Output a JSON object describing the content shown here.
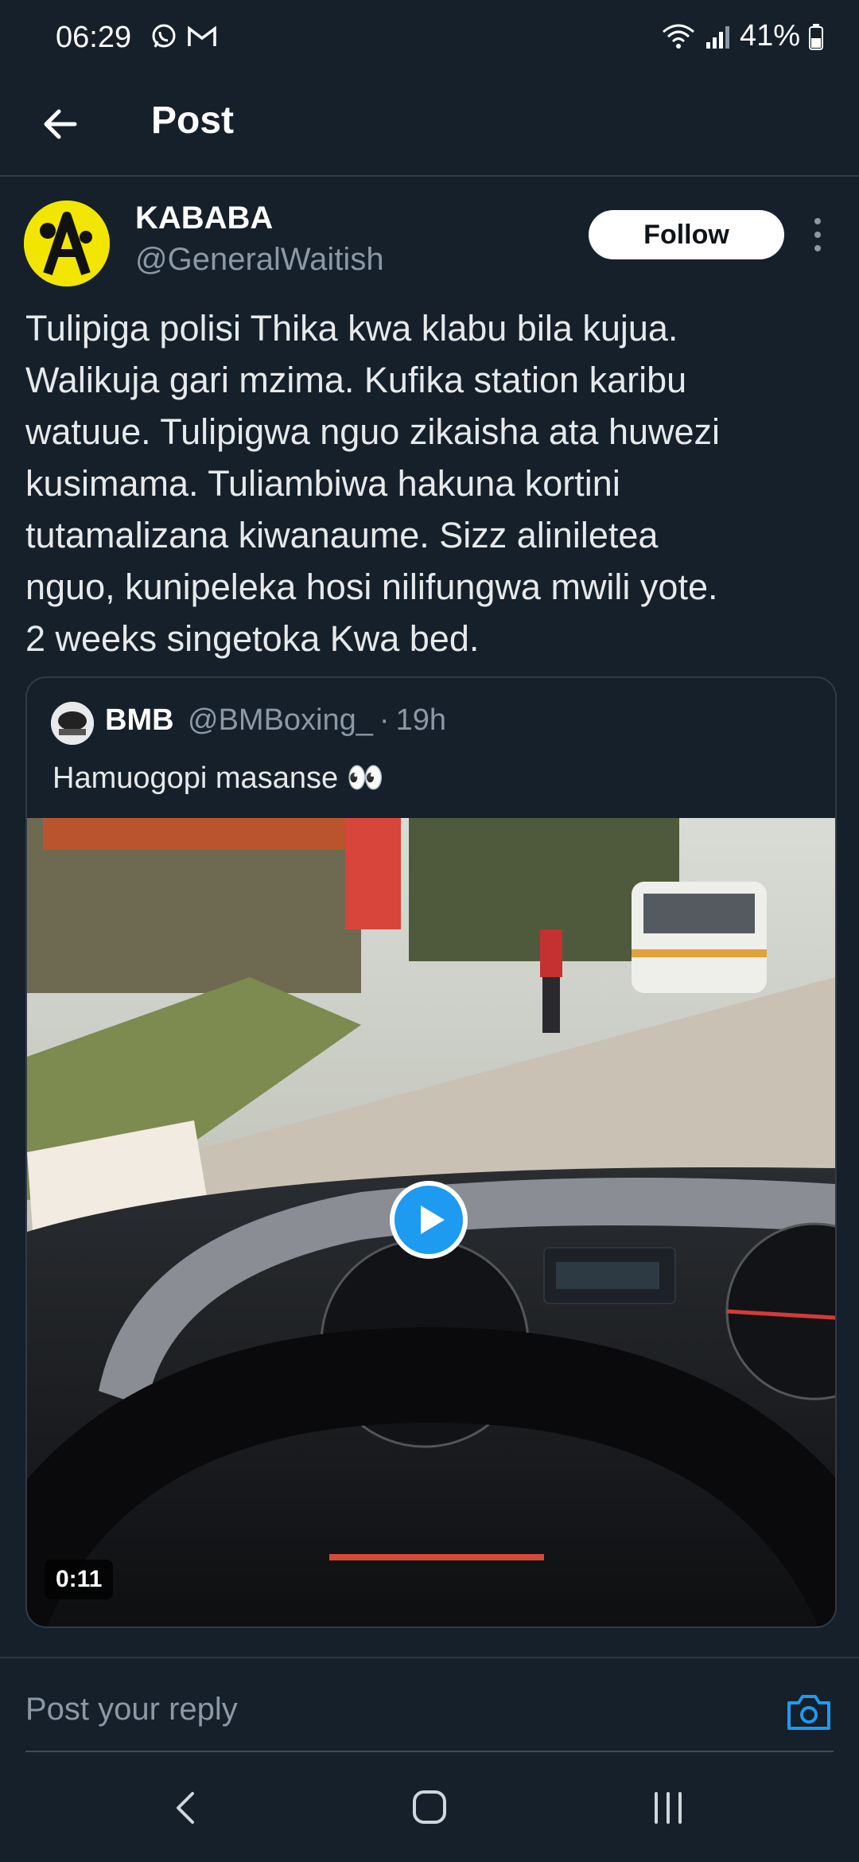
{
  "status_bar": {
    "time": "06:29",
    "battery": "41%",
    "left_icons": [
      "whatsapp-icon",
      "gmail-icon"
    ],
    "right_icons": [
      "wifi-icon",
      "signal-icon",
      "battery-icon"
    ]
  },
  "header": {
    "title": "Post",
    "back_icon": "arrow-left-icon"
  },
  "post": {
    "author_name": "KABABA",
    "author_handle": "@GeneralWaitish",
    "follow_label": "Follow",
    "text": "Tulipiga polisi Thika kwa klabu bila kujua.\nWalikuja gari mzima. Kufika station karibu\nwatuue. Tulipigwa nguo zikaisha ata huwezi\nkusimama. Tuliambiwa hakuna kortini\ntutamalizana kiwanaume. Sizz aliniletea\nnguo, kunipeleka hosi nilifungwa mwili yote.\n2 weeks singetoka Kwa bed."
  },
  "quote": {
    "name": "BMB",
    "handle": "@BMBoxing_",
    "separator": "·",
    "time": "19h",
    "text": "Hamuogopi masanse 👀",
    "video_duration": "0:11"
  },
  "reply": {
    "placeholder": "Post your reply",
    "camera_icon": "camera-icon"
  },
  "nav": {
    "icons": [
      "back-nav-icon",
      "home-nav-icon",
      "recents-nav-icon"
    ]
  },
  "colors": {
    "background": "#15202b",
    "accent": "#1d9bf0",
    "text_primary": "#e7e9ea",
    "text_secondary": "#8b98a5",
    "divider": "#2f3b47"
  }
}
